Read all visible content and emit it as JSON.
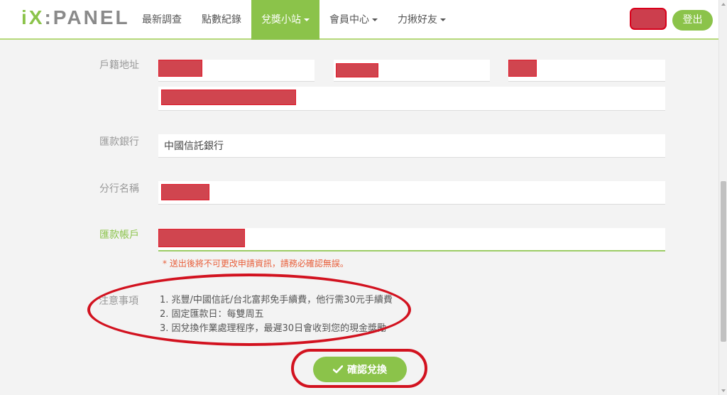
{
  "logo": {
    "prefix": "iX",
    "rest": ":PANEL"
  },
  "nav": {
    "items": [
      {
        "label": "最新調查",
        "dropdown": false,
        "active": false
      },
      {
        "label": "點數紀錄",
        "dropdown": false,
        "active": false
      },
      {
        "label": "兌獎小站",
        "dropdown": true,
        "active": true
      },
      {
        "label": "會員中心",
        "dropdown": true,
        "active": false
      },
      {
        "label": "力揪好友",
        "dropdown": true,
        "active": false
      }
    ],
    "logout_label": "登出"
  },
  "form": {
    "address_label": "戶籍地址",
    "bank_label": "匯款銀行",
    "bank_value": "中國信託銀行",
    "branch_label": "分行名稱",
    "account_label": "匯款帳戶",
    "warning": "* 送出後將不可更改申請資訊，請務必確認無誤。",
    "notes_label": "注意事項",
    "notes": [
      "1. 兆豐/中國信託/台北富邦免手續費，他行需30元手續費",
      "2. 固定匯款日：每雙周五",
      "3. 因兌換作業處理程序，最遲30日會收到您的現金獎勵"
    ],
    "confirm_label": "確認兌換"
  },
  "colors": {
    "accent": "#8bc34a",
    "annotation_red": "#d2121f",
    "redaction": "#d0454f",
    "warning": "#e8603c"
  },
  "icons": {
    "confirm": "check-icon"
  }
}
